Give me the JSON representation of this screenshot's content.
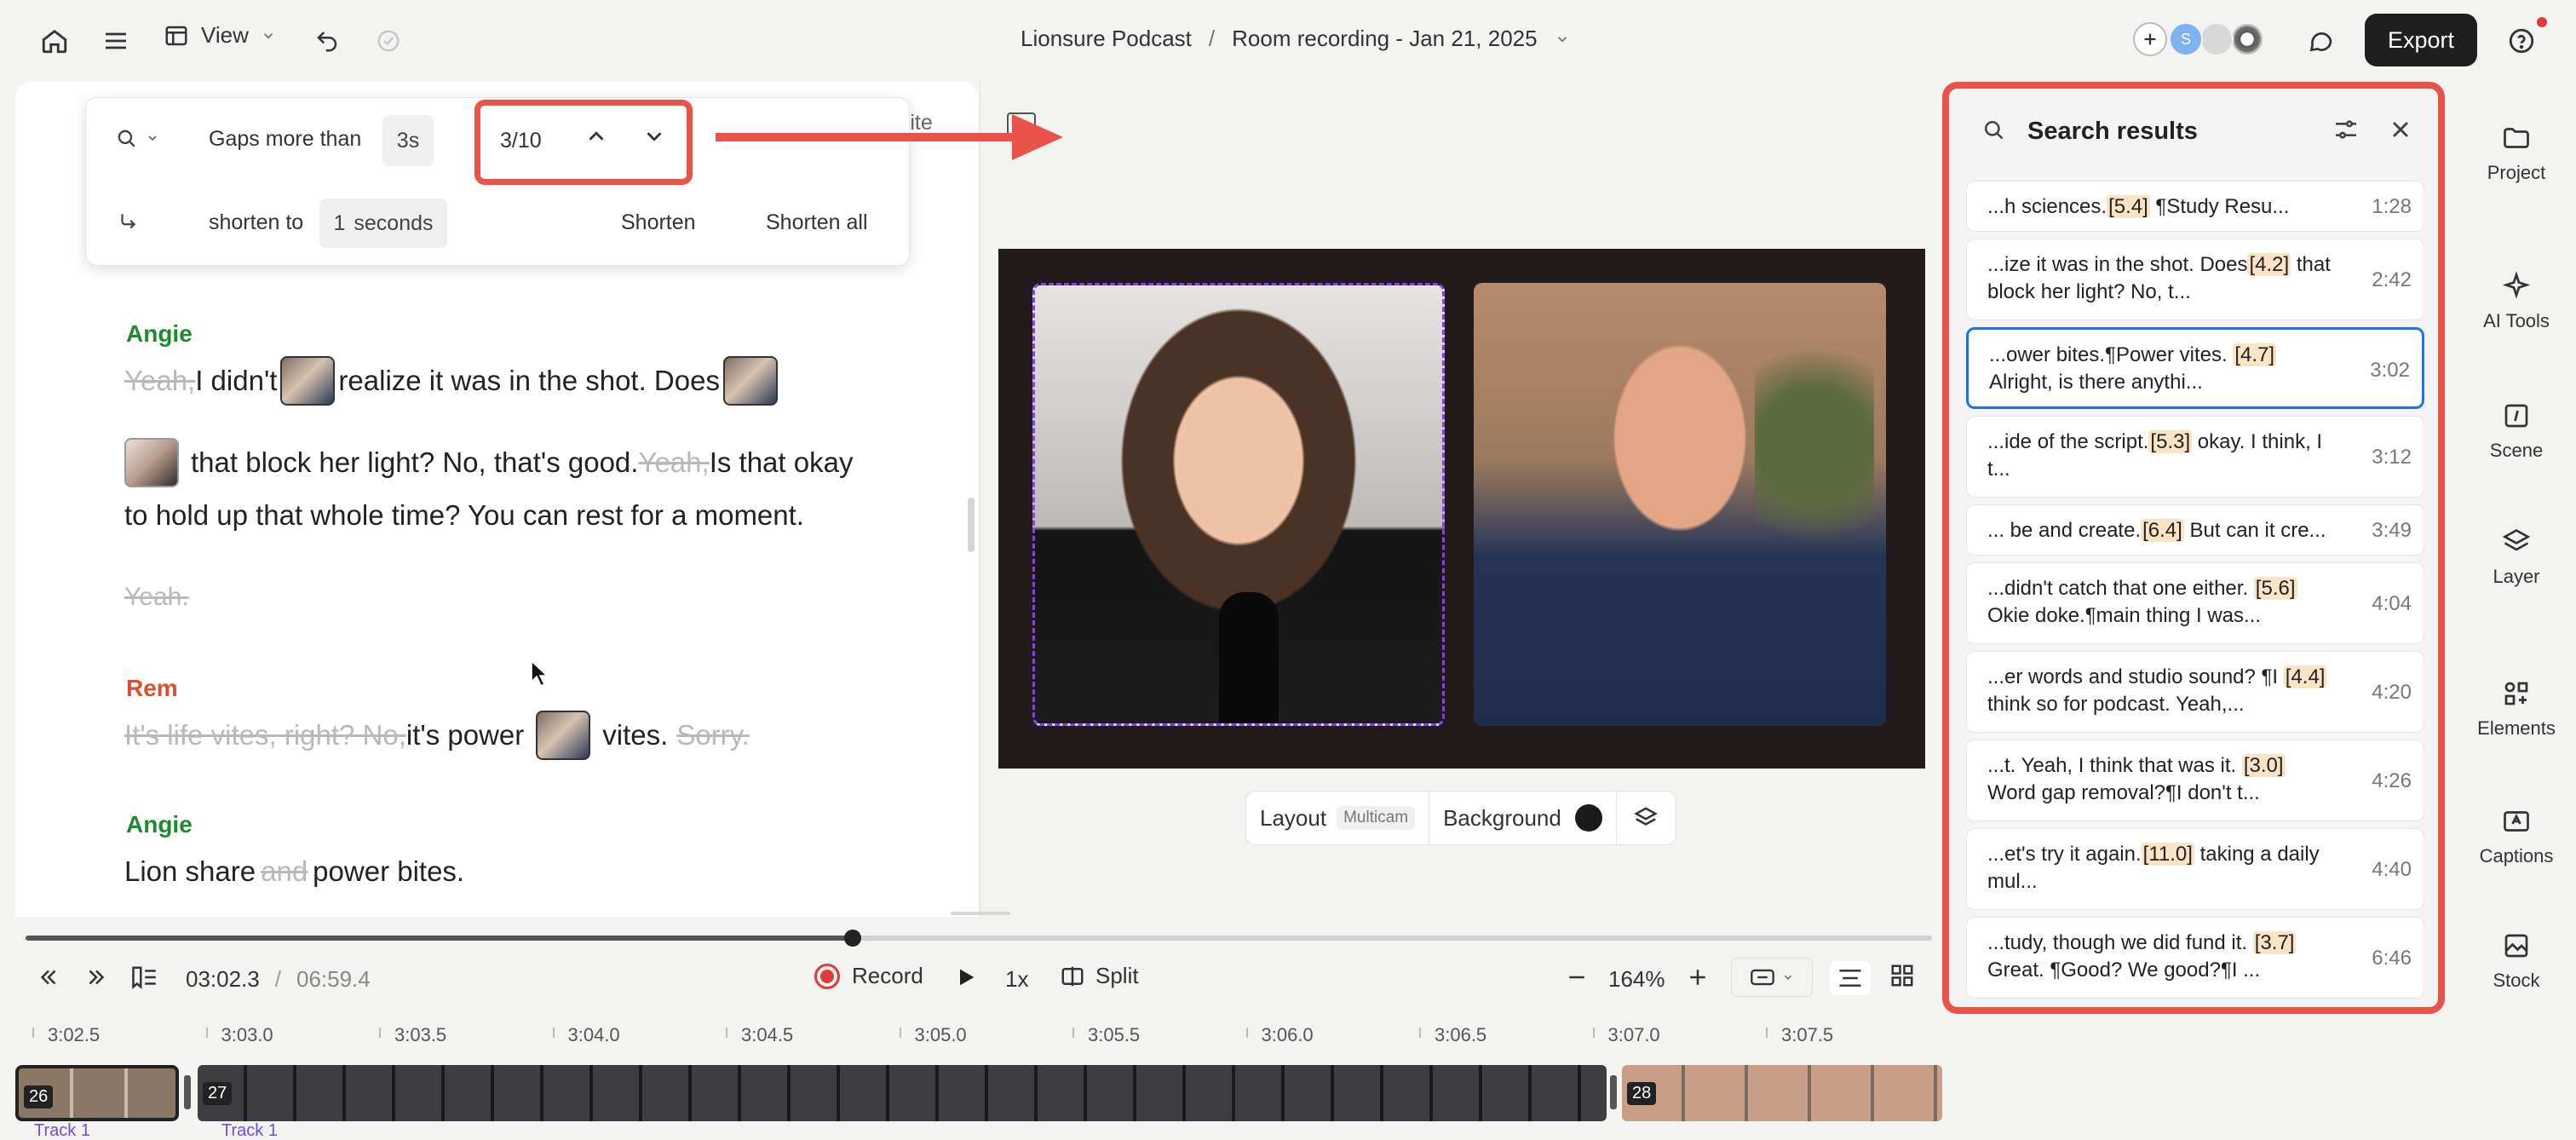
{
  "header": {
    "view_label": "View",
    "project_name": "Lionsure Podcast",
    "separator": "/",
    "recording_name": "Room recording - Jan 21, 2025",
    "avatar_letter": "S",
    "export_label": "Export"
  },
  "gap_search": {
    "gaps_label": "Gaps more than",
    "gaps_value": "3s",
    "counter": "3/10",
    "shorten_to_label": "shorten to",
    "shorten_value": "1",
    "seconds_label": "seconds",
    "shorten_label": "Shorten",
    "shorten_all_label": "Shorten all",
    "obscured_text": "rite"
  },
  "transcript": {
    "s1_name": "Angie",
    "b1_strike": "Yeah, ",
    "b1_a": "I didn't",
    "b1_b": "realize it was in the shot. Does",
    "b1_c": "that block her light? No, that's good.",
    "b1_strike2": "Yeah, ",
    "b1_d": "Is that okay",
    "b1_e": "to hold up that whole time? You can rest for a moment.",
    "b1_strike3": "Yeah.",
    "s2_name": "Rem",
    "b2_strike": "It's life vites, right? No, ",
    "b2_a": "it's power",
    "b2_b": "vites.",
    "b2_strike2": "Sorry.",
    "s3_name": "Angie",
    "b3_a": "Lion share",
    "b3_strike": "and",
    "b3_b": "power bites."
  },
  "preview_controls": {
    "layout_label": "Layout",
    "layout_badge": "Multicam",
    "background_label": "Background"
  },
  "search_results": {
    "title": "Search results",
    "items": [
      {
        "pre": "...h sciences.",
        "tag": "[5.4]",
        "post": " ¶Study Resu...",
        "time": "1:28"
      },
      {
        "pre": "...ize it was in the shot. Does",
        "tag": "[4.2]",
        "post": " that block her light? No, t...",
        "time": "2:42"
      },
      {
        "pre": "...ower bites.¶Power vites. ",
        "tag": "[4.7]",
        "post": " Alright, is there anythi...",
        "time": "3:02"
      },
      {
        "pre": "...ide of the script.",
        "tag": "[5.3]",
        "post": " okay. I think, I t...",
        "time": "3:12"
      },
      {
        "pre": "... be and create.",
        "tag": "[6.4]",
        "post": " But can it cre...",
        "time": "3:49"
      },
      {
        "pre": "...didn't catch that one either. ",
        "tag": "[5.6]",
        "post": " Okie doke.¶main thing I was...",
        "time": "4:04"
      },
      {
        "pre": "...er words and studio sound? ¶I ",
        "tag": "[4.4]",
        "post": " think so for podcast. Yeah,...",
        "time": "4:20"
      },
      {
        "pre": "...t. Yeah, I think that was it. ",
        "tag": "[3.0]",
        "post": " Word gap removal?¶I don't t...",
        "time": "4:26"
      },
      {
        "pre": "...et's try it again.",
        "tag": "[11.0]",
        "post": " taking a daily mul...",
        "time": "4:40"
      },
      {
        "pre": "...tudy, though we did fund it. ",
        "tag": "[3.7]",
        "post": " Great. ¶Good? We good?¶I ...",
        "time": "6:46"
      }
    ]
  },
  "rail": {
    "project": "Project",
    "ai_tools": "AI Tools",
    "scene": "Scene",
    "layer": "Layer",
    "elements": "Elements",
    "captions": "Captions",
    "stock": "Stock"
  },
  "playback": {
    "current": "03:02.3",
    "sep": "/",
    "total": "06:59.4",
    "record_label": "Record",
    "speed": "1x",
    "split_label": "Split",
    "zoom": "164%",
    "progress": 0.434
  },
  "ruler": [
    "3:02.5",
    "3:03.0",
    "3:03.5",
    "3:04.0",
    "3:04.5",
    "3:05.0",
    "3:05.5",
    "3:06.0",
    "3:06.5",
    "3:07.0",
    "3:07.5"
  ],
  "clips": {
    "c1": "26",
    "c2": "27",
    "c3": "28",
    "track": "Track 1"
  },
  "colors": {
    "accent_red": "#e9534a",
    "angie": "#1f8a2c",
    "rem": "#d9502f",
    "highlight": "#fbe3c5",
    "selected": "#1a73e8"
  }
}
